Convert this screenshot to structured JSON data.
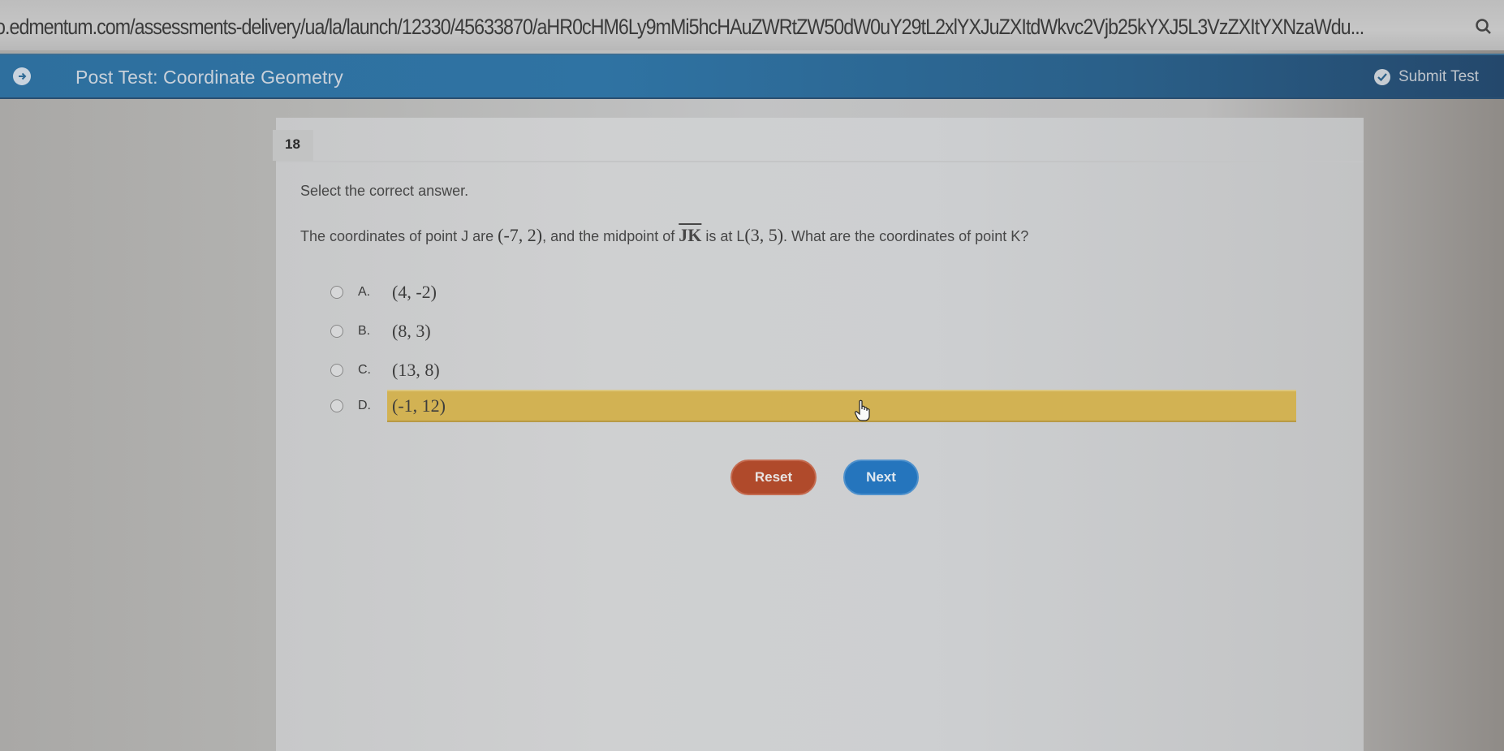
{
  "browser": {
    "url": "o.edmentum.com/assessments-delivery/ua/la/launch/12330/45633870/aHR0cHM6Ly9mMi5hcHAuZWRtZW50dW0uY29tL2xlYXJuZXItdWkvc2Vjb25kYXJ5L3VzZXItYXNzaWdu...",
    "search_icon": "magnifier-icon"
  },
  "header": {
    "title": "Post Test: Coordinate Geometry",
    "back_icon": "arrow-circle-icon",
    "submit_label": "Submit Test",
    "submit_icon": "check-circle-icon",
    "bg_color": "#2f73a3"
  },
  "question": {
    "number": "18",
    "instruction": "Select the correct answer.",
    "prompt_parts": {
      "p1": "The coordinates of point J are ",
      "j_coords": "(-7, 2)",
      "p2": ", and the midpoint of ",
      "segment": "JK",
      "p3": " is at L",
      "l_coords": "(3, 5)",
      "p4": ". What are the coordinates of point K?"
    },
    "options": [
      {
        "letter": "A.",
        "value": "(4, -2)",
        "selected": false
      },
      {
        "letter": "B.",
        "value": "(8, 3)",
        "selected": false
      },
      {
        "letter": "C.",
        "value": "(13, 8)",
        "selected": false
      },
      {
        "letter": "D.",
        "value": "(-1, 12)",
        "selected": true
      }
    ],
    "highlight_color": "#d2b253"
  },
  "actions": {
    "reset_label": "Reset",
    "next_label": "Next",
    "reset_color": "#b04a2b",
    "next_color": "#2575bd"
  }
}
